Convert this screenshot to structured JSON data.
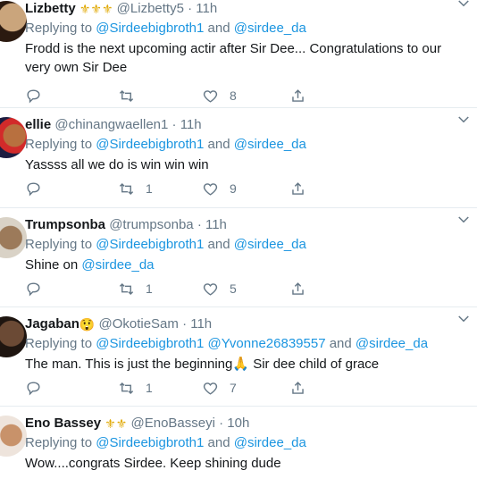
{
  "colors": {
    "accent": "#1b95e0",
    "muted": "#657786",
    "text": "#14171a",
    "divider": "#e6ecf0"
  },
  "tweets": [
    {
      "name": "Lizbetty",
      "badges": "⚜⚜⚜",
      "handle": "@Lizbetty5",
      "dot": "·",
      "time": "11h",
      "replying_prefix": "Replying to",
      "mentions": [
        "@Sirdeebigbroth1",
        "@sirdee_da"
      ],
      "text": "Frodd is the next upcoming actir after Sir Dee... Congratulations to our very own Sir Dee",
      "retweets": "",
      "likes": "8"
    },
    {
      "name": "ellie",
      "handle": "@chinangwaellen1",
      "dot": "·",
      "time": "11h",
      "replying_prefix": "Replying to",
      "mentions": [
        "@Sirdeebigbroth1",
        "@sirdee_da"
      ],
      "text": "Yassss all we do is win win win",
      "retweets": "1",
      "likes": "9"
    },
    {
      "name": "Trumpsonba",
      "handle": "@trumpsonba",
      "dot": "·",
      "time": "11h",
      "replying_prefix": "Replying to",
      "mentions": [
        "@Sirdeebigbroth1",
        "@sirdee_da"
      ],
      "text_prefix": "Shine on",
      "text_mention": "@sirdee_da",
      "retweets": "1",
      "likes": "5"
    },
    {
      "name": "Jagaban",
      "badges": "😲",
      "handle": "@OkotieSam",
      "dot": "·",
      "time": "11h",
      "replying_prefix": "Replying to",
      "mentions": [
        "@Sirdeebigbroth1",
        "@Yvonne26839557",
        "@sirdee_da"
      ],
      "text_a": "The man. This is just the beginning",
      "text_emoji": "🙏",
      "text_b": " Sir dee child of grace",
      "retweets": "1",
      "likes": "7"
    },
    {
      "name": "Eno Bassey",
      "badges": "⚜⚜",
      "handle": "@EnoBasseyi",
      "dot": "·",
      "time": "10h",
      "replying_prefix": "Replying to",
      "mentions": [
        "@Sirdeebigbroth1",
        "@sirdee_da"
      ],
      "text": "Wow....congrats Sirdee. Keep shining dude"
    }
  ],
  "conjunction": "and"
}
